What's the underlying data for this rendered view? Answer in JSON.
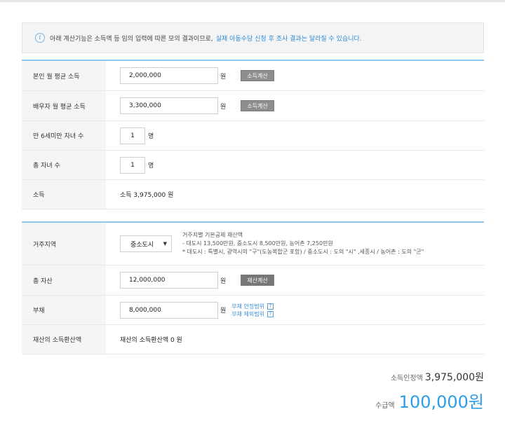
{
  "notice": {
    "text": "아래 계산기능은 소득액 등 임의 입력에 따른 모의 결과이므로,",
    "highlight": "실제 아동수당 신청 후 조사 결과는 달라질 수 있습니다."
  },
  "income": {
    "self": {
      "label": "본인 월 평균 소득",
      "value": "2,000,000",
      "unit": "원",
      "button": "소득계산"
    },
    "spouse": {
      "label": "배우자 월 평균 소득",
      "value": "3,300,000",
      "unit": "원",
      "button": "소득계산"
    },
    "children_under6": {
      "label": "만 6세미만 자녀 수",
      "value": "1",
      "unit": "명"
    },
    "children_total": {
      "label": "총 자녀 수",
      "value": "1",
      "unit": "명"
    },
    "income_total": {
      "label": "소득",
      "value": "소득 3,975,000 원"
    }
  },
  "assets": {
    "region": {
      "label": "거주지역",
      "selected": "중소도시",
      "note1": "거주지별 기본공제 재산액",
      "note2": "- 대도시 13,500만원, 중소도시 8,500만원, 농어촌 7,250만원",
      "note3": "* 대도시 : 특별시, 광역시의 \"구\"(도농복합군 포함) / 중소도시 : 도의 \"시\" ,세종시 / 농어촌 : 도의 \"군\""
    },
    "total_assets": {
      "label": "총 자산",
      "value": "12,000,000",
      "unit": "원",
      "button": "재산계산"
    },
    "debt": {
      "label": "부채",
      "value": "8,000,000",
      "unit": "원",
      "link1": "부채 인정범위",
      "link2": "부채 제외범위",
      "help": "?"
    },
    "converted": {
      "label": "재산의 소득환산액",
      "value": "재산의 소득환산액 0 원"
    }
  },
  "summary": {
    "recognized_label": "소득인정액",
    "recognized_value": "3,975,000원",
    "payment_label": "수급액",
    "payment_value": "100,000원"
  }
}
